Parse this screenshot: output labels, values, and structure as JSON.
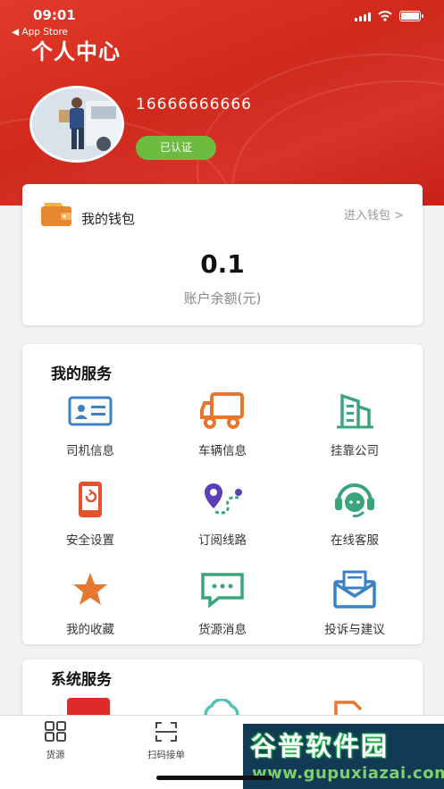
{
  "status_bar": {
    "time": "09:01",
    "back_label": "◀ App Store"
  },
  "header": {
    "title": "个人中心",
    "phone": "16666666666",
    "verified_label": "已认证"
  },
  "wallet": {
    "title": "我的钱包",
    "link": "进入钱包 >",
    "balance": "0.1",
    "balance_label": "账户余额(元)"
  },
  "services": {
    "title": "我的服务",
    "items": [
      {
        "label": "司机信息",
        "icon": "driver-card-icon"
      },
      {
        "label": "车辆信息",
        "icon": "truck-icon"
      },
      {
        "label": "挂靠公司",
        "icon": "company-building-icon"
      },
      {
        "label": "安全设置",
        "icon": "security-phone-icon"
      },
      {
        "label": "订阅线路",
        "icon": "route-icon"
      },
      {
        "label": "在线客服",
        "icon": "headset-icon"
      },
      {
        "label": "我的收藏",
        "icon": "star-icon"
      },
      {
        "label": "货源消息",
        "icon": "message-icon"
      },
      {
        "label": "投诉与建议",
        "icon": "mail-icon"
      }
    ]
  },
  "system_services": {
    "title": "系统服务"
  },
  "tabbar": {
    "items": [
      {
        "label": "货源",
        "icon": "grid-icon"
      },
      {
        "label": "扫码接单",
        "icon": "scan-icon"
      }
    ]
  },
  "watermark": {
    "title": "谷普软件园",
    "url": "www.gupuxiazai.com"
  },
  "colors": {
    "header_red": "#d8302a",
    "verified_green": "#6dbb3f",
    "icon_blue": "#3b82c4",
    "icon_orange": "#e6772e",
    "icon_green": "#3aa57a",
    "icon_purple": "#5b3fb7"
  }
}
